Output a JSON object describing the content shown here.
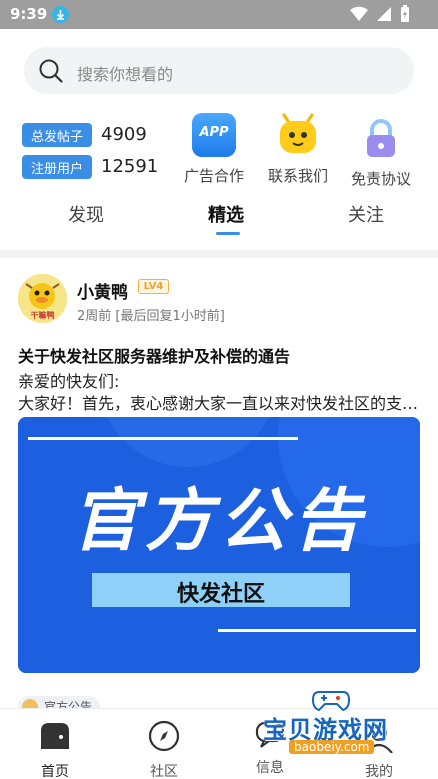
{
  "status_bar": {
    "time": "9:39"
  },
  "search": {
    "placeholder": "搜索你想看的"
  },
  "stats": [
    {
      "label": "总发帖子",
      "value": "4909"
    },
    {
      "label": "注册用户",
      "value": "12591"
    }
  ],
  "quick_actions": [
    {
      "label": "广告合作",
      "icon": "app-icon",
      "icon_text": "APP"
    },
    {
      "label": "联系我们",
      "icon": "robot-icon"
    },
    {
      "label": "免责协议",
      "icon": "lock-icon"
    }
  ],
  "tabs": [
    {
      "label": "发现"
    },
    {
      "label": "精选"
    },
    {
      "label": "关注"
    }
  ],
  "post": {
    "author": "小黄鸭",
    "level": "LV4",
    "avatar_caption": "干嘛鸭",
    "meta": "2周前 [最后回复1小时前]",
    "title": "关于快发社区服务器维护及补偿的通告",
    "body_line1": "亲爱的快友们:",
    "body_line2": "大家好！首先，衷心感谢大家一直以来对快发社区的支持与厚爱",
    "banner_title": "官方公告",
    "banner_subtitle": "快发社区"
  },
  "next_post": {
    "chip": "官方公告"
  },
  "bottom_nav": [
    {
      "label": "首页"
    },
    {
      "label": "社区"
    },
    {
      "label": "信息"
    },
    {
      "label": "我的"
    }
  ],
  "watermark": {
    "text": "宝贝游戏网",
    "url": "baobeiy.com"
  },
  "colors": {
    "accent": "#3a8ee6",
    "banner": "#1c60e0",
    "status_bar": "#9e9e9e"
  }
}
